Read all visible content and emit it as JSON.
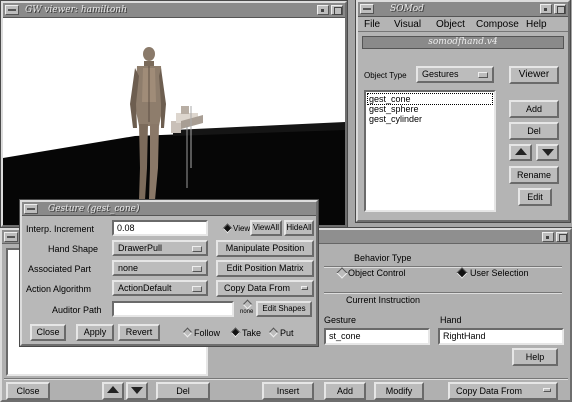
{
  "viewer": {
    "title": "GW viewer: hamiltonh"
  },
  "somod": {
    "title": "SOMod",
    "menu": [
      "File",
      "Visual",
      "Object",
      "Compose",
      "Help"
    ],
    "subtitle": "somodfhand.v4",
    "object_type_label": "Object Type",
    "object_type_value": "Gestures",
    "list_items": [
      "gest_cone",
      "gest_sphere",
      "gest_cylinder"
    ],
    "buttons": {
      "viewer": "Viewer",
      "add": "Add",
      "del": "Del",
      "rename": "Rename",
      "edit": "Edit"
    }
  },
  "gesture_dialog": {
    "title": "Gesture (gest_cone)",
    "interp_label": "Interp. Increment",
    "interp_value": "0.08",
    "view_label": "View",
    "view_all": "ViewAll",
    "hide_all": "HideAll",
    "hand_shape_label": "Hand Shape",
    "hand_shape_value": "DrawerPull",
    "manipulate_position": "Manipulate Position",
    "associated_part_label": "Associated Part",
    "associated_part_value": "none",
    "edit_position_matrix": "Edit Position Matrix",
    "action_algorithm_label": "Action Algorithm",
    "action_algorithm_value": "ActionDefault",
    "copy_data_from": "Copy Data From",
    "auditor_path_label": "Auditor Path",
    "auditor_path_value": "",
    "auditor_small_label": "none",
    "edit_shapes": "Edit Shapes",
    "close": "Close",
    "apply": "Apply",
    "revert": "Revert",
    "radio_follow": "Follow",
    "radio_take": "Take",
    "radio_put": "Put",
    "radio_selected": "take"
  },
  "behavior": {
    "behavior_type_label": "Behavior Type",
    "object_control": "Object Control",
    "user_selection": "User Selection",
    "selected": "user_selection",
    "current_instruction_label": "Current Instruction",
    "gesture_label": "Gesture",
    "gesture_value": "st_cone",
    "hand_label": "Hand",
    "hand_value": "RightHand",
    "help": "Help"
  },
  "bottom_bar": {
    "close": "Close",
    "del": "Del",
    "insert": "Insert",
    "add": "Add",
    "modify": "Modify",
    "copy_data_from": "Copy Data From"
  }
}
